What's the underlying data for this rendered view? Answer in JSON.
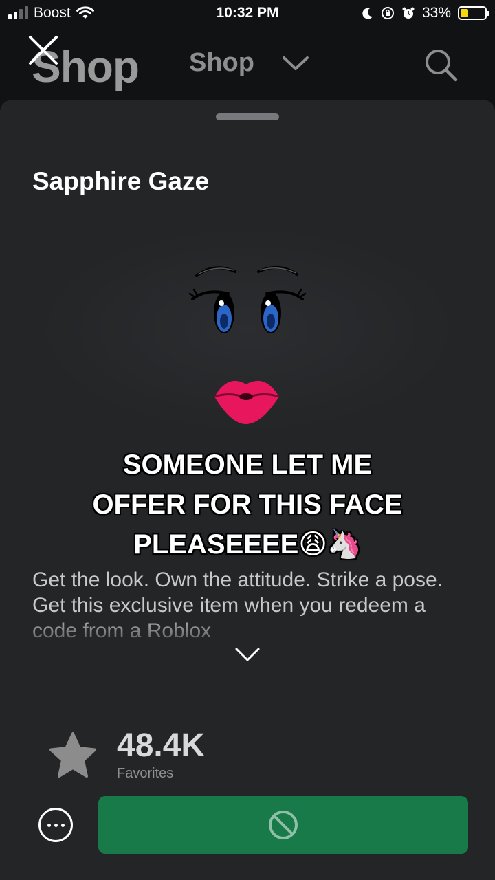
{
  "status_bar": {
    "carrier": "Boost",
    "time": "10:32 PM",
    "battery": "33%",
    "battery_color": "#f5d90a"
  },
  "header": {
    "large_title": "Shop",
    "menu_label": "Shop",
    "icons": [
      "close-icon",
      "chevron-down-icon",
      "search-icon"
    ]
  },
  "item": {
    "title": "Sapphire Gaze",
    "description": "Get the look. Own the attitude. Strike a pose. Get this exclusive item when you redeem a code from a Roblox",
    "favorites_count": "48.4K",
    "favorites_label": "Favorites"
  },
  "overlay_caption": {
    "line1": "SOMEONE LET ME",
    "line2": "OFFER FOR THIS FACE",
    "line3": "PLEASEEEE😩🦄"
  },
  "actions": {
    "more_icon": "ellipsis-icon",
    "buy_icon": "blocked-icon",
    "buy_color": "#197a49"
  }
}
